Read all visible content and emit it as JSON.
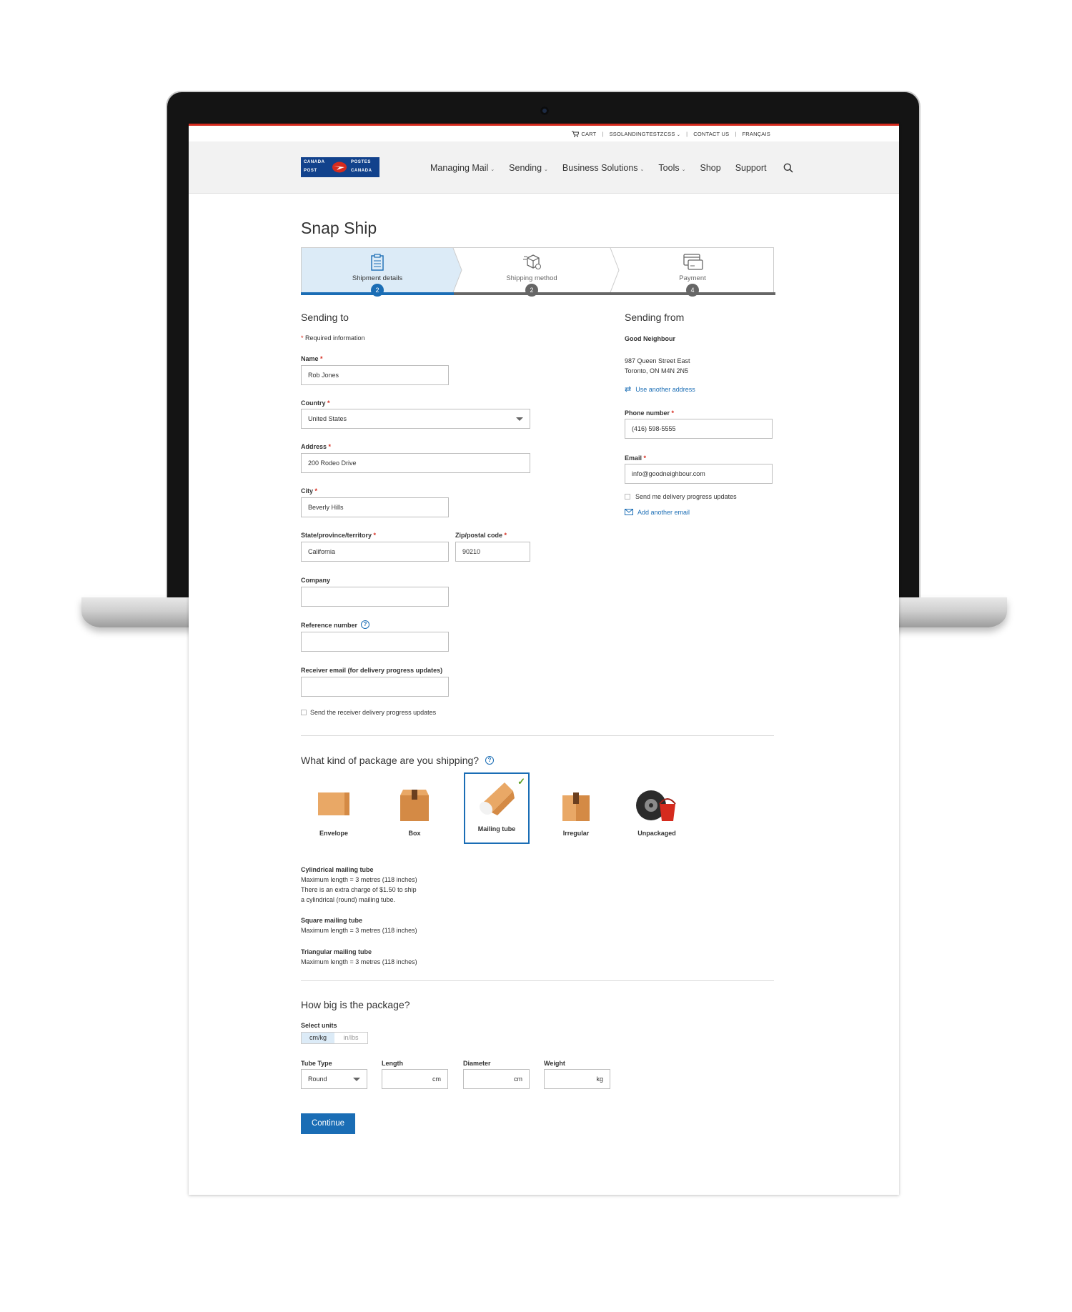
{
  "utility_nav": {
    "cart": "CART",
    "account": "SSOLANDINGTESTZCSS",
    "contact": "CONTACT US",
    "language": "FRANÇAIS"
  },
  "logo": {
    "line1_left": "CANADA",
    "line1_right": "POSTES",
    "line2_left": "POST",
    "line2_right": "CANADA"
  },
  "main_nav": {
    "items": [
      {
        "label": "Managing Mail",
        "has_dropdown": true
      },
      {
        "label": "Sending",
        "has_dropdown": true
      },
      {
        "label": "Business Solutions",
        "has_dropdown": true
      },
      {
        "label": "Tools",
        "has_dropdown": true
      },
      {
        "label": "Shop",
        "has_dropdown": false
      },
      {
        "label": "Support",
        "has_dropdown": false
      }
    ],
    "search_icon": "search-icon"
  },
  "page_title": "Snap Ship",
  "stepper": {
    "steps": [
      {
        "label": "Shipment details",
        "number": "2",
        "icon": "clipboard-icon",
        "active": true
      },
      {
        "label": "Shipping method",
        "number": "2",
        "icon": "shipping-box-icon",
        "active": false
      },
      {
        "label": "Payment",
        "number": "4",
        "icon": "credit-card-icon",
        "active": false
      }
    ]
  },
  "sending_to": {
    "title": "Sending to",
    "required_note": "Required information",
    "name": {
      "label": "Name",
      "value": "Rob Jones"
    },
    "country": {
      "label": "Country",
      "value": "United States"
    },
    "address": {
      "label": "Address",
      "value": "200 Rodeo Drive"
    },
    "city": {
      "label": "City",
      "value": "Beverly Hills"
    },
    "state": {
      "label": "State/province/territory",
      "value": "California"
    },
    "zip": {
      "label": "Zip/postal code",
      "value": "90210"
    },
    "company": {
      "label": "Company",
      "value": ""
    },
    "reference": {
      "label": "Reference number",
      "value": ""
    },
    "receiver_email": {
      "label": "Receiver email (for delivery progress updates)",
      "value": ""
    },
    "receiver_updates_label": "Send the receiver delivery progress updates"
  },
  "sending_from": {
    "title": "Sending from",
    "name": "Good Neighbour",
    "address_line1": "987 Queen Street East",
    "address_line2": "Toronto, ON M4N 2N5",
    "use_another_address": "Use another address",
    "phone": {
      "label": "Phone number",
      "value": "(416) 598-5555"
    },
    "email": {
      "label": "Email",
      "value": "info@goodneighbour.com"
    },
    "updates_label": "Send me delivery progress updates",
    "add_email": "Add another email"
  },
  "package_kind": {
    "title": "What kind of package are you shipping?",
    "options": [
      {
        "label": "Envelope",
        "icon": "envelope-icon",
        "selected": false
      },
      {
        "label": "Box",
        "icon": "box-icon",
        "selected": false
      },
      {
        "label": "Mailing tube",
        "icon": "mailing-tube-icon",
        "selected": true
      },
      {
        "label": "Irregular",
        "icon": "irregular-package-icon",
        "selected": false
      },
      {
        "label": "Unpackaged",
        "icon": "tire-and-bucket-icon",
        "selected": false
      }
    ],
    "descriptions": [
      {
        "title": "Cylindrical mailing tube",
        "lines": [
          "Maximum length = 3 metres (118 inches)",
          "There is an extra charge of $1.50 to ship",
          "a cylindrical (round) mailing tube."
        ]
      },
      {
        "title": "Square mailing tube",
        "lines": [
          "Maximum length = 3 metres (118 inches)"
        ]
      },
      {
        "title": "Triangular mailing tube",
        "lines": [
          "Maximum length = 3 metres (118 inches)"
        ]
      }
    ]
  },
  "package_size": {
    "title": "How big is the package?",
    "units_label": "Select units",
    "unit_metric": "cm/kg",
    "unit_imperial": "in/lbs",
    "tube_type": {
      "label": "Tube Type",
      "value": "Round"
    },
    "length": {
      "label": "Length",
      "unit": "cm"
    },
    "diameter": {
      "label": "Diameter",
      "unit": "cm"
    },
    "weight": {
      "label": "Weight",
      "unit": "kg"
    }
  },
  "continue_label": "Continue",
  "colors": {
    "brand_red": "#d52b1e",
    "brand_blue": "#12428c",
    "accent_blue": "#1a6db5",
    "success_green": "#5a9e1f"
  }
}
